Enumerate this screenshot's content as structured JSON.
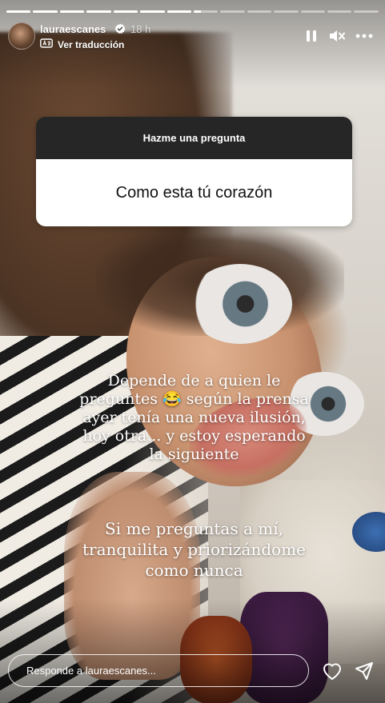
{
  "story": {
    "segments_total": 14,
    "segments_seen": 7,
    "current_segment_progress": 0.3
  },
  "header": {
    "username": "lauraescanes",
    "time": "18 h",
    "translate_label": "Ver traducción",
    "icons": {
      "verified": "verified-badge-icon",
      "translate": "translate-icon",
      "pause": "pause-icon",
      "mute": "mute-icon",
      "more": "more-options-icon"
    }
  },
  "question_sticker": {
    "title": "Hazme una pregunta",
    "question": "Como esta tú corazón"
  },
  "caption": {
    "paragraph1": [
      "Depende de a quien le",
      "preguntes 😂 según la prensa",
      "ayer tenía una nueva ilusión,",
      "hoy otra... y estoy esperando",
      "la siguiente"
    ],
    "paragraph2": [
      "Si me preguntas a mí,",
      "tranquilita y priorizándome",
      "como nunca"
    ]
  },
  "footer": {
    "reply_placeholder": "Responde a lauraescanes...",
    "icons": {
      "like": "heart-icon",
      "share": "send-icon"
    }
  },
  "colors": {
    "sticker_header_bg": "#262626",
    "sticker_body_bg": "#ffffff",
    "progress_empty": "rgba(255,255,255,0.45)",
    "progress_full": "#ffffff"
  }
}
